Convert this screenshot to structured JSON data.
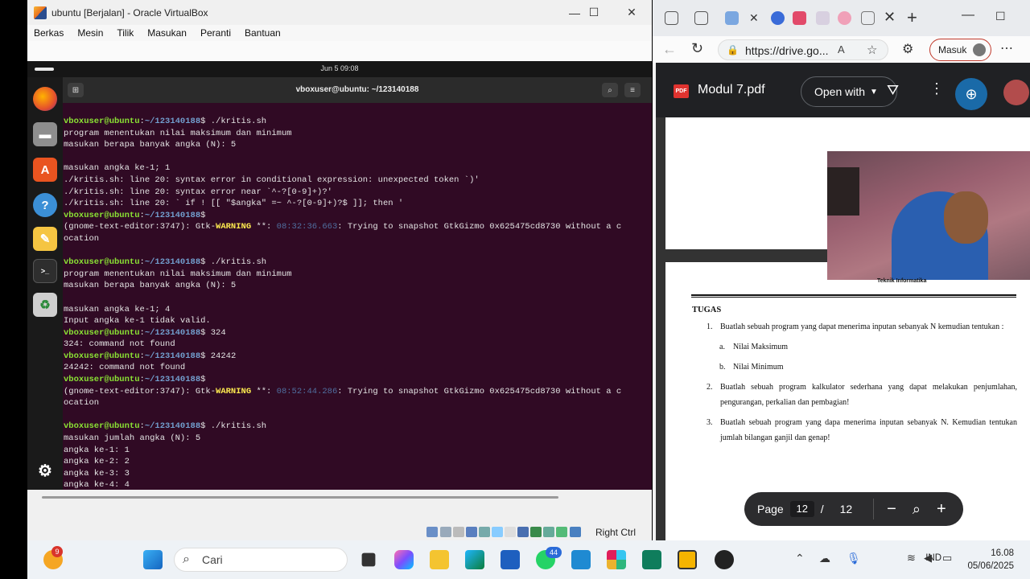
{
  "vbox": {
    "title": "ubuntu [Berjalan] - Oracle VirtualBox",
    "menu": [
      "Berkas",
      "Mesin",
      "Tilik",
      "Masukan",
      "Peranti",
      "Bantuan"
    ],
    "host_key": "Right Ctrl"
  },
  "guest": {
    "clock": "Jun 5  09:08",
    "terminal_title": "vboxuser@ubuntu: ~/123140188"
  },
  "terminal": {
    "user_host": "vboxuser@ubuntu",
    "path": "~/123140188",
    "lines": [
      {
        "type": "prompt",
        "cmd": " ./kritis.sh"
      },
      {
        "type": "text",
        "text": "program menentukan nilai maksimum dan minimum"
      },
      {
        "type": "text",
        "text": "masukan berapa banyak angka (N): 5"
      },
      {
        "type": "text",
        "text": ""
      },
      {
        "type": "text",
        "text": "masukan angka ke-1; 1"
      },
      {
        "type": "text",
        "text": "./kritis.sh: line 20: syntax error in conditional expression: unexpected token `)'"
      },
      {
        "type": "text",
        "text": "./kritis.sh: line 20: syntax error near `^-?[0-9]+)?'"
      },
      {
        "type": "text",
        "text": "./kritis.sh: line 20: ` if ! [[ \"$angka\" =~ ^-?[0-9]+)?$ ]]; then '"
      },
      {
        "type": "prompt",
        "cmd": ""
      },
      {
        "type": "warn",
        "pre": "(gnome-text-editor:3747): Gtk-",
        "warn": "WARNING",
        "mid": " **: ",
        "time": "08:32:36.663",
        "post": ": Trying to snapshot GtkGizmo 0x625475cd8730 without a c"
      },
      {
        "type": "text",
        "text": "ocation"
      },
      {
        "type": "text",
        "text": ""
      },
      {
        "type": "prompt",
        "cmd": " ./kritis.sh"
      },
      {
        "type": "text",
        "text": "program menentukan nilai maksimum dan minimum"
      },
      {
        "type": "text",
        "text": "masukan berapa banyak angka (N): 5"
      },
      {
        "type": "text",
        "text": ""
      },
      {
        "type": "text",
        "text": "masukan angka ke-1; 4"
      },
      {
        "type": "text",
        "text": "Input angka ke-1 tidak valid."
      },
      {
        "type": "prompt",
        "cmd": " 324"
      },
      {
        "type": "text",
        "text": "324: command not found"
      },
      {
        "type": "prompt",
        "cmd": " 24242"
      },
      {
        "type": "text",
        "text": "24242: command not found"
      },
      {
        "type": "prompt",
        "cmd": ""
      },
      {
        "type": "warn",
        "pre": "(gnome-text-editor:3747): Gtk-",
        "warn": "WARNING",
        "mid": " **: ",
        "time": "08:52:44.286",
        "post": ": Trying to snapshot GtkGizmo 0x625475cd8730 without a c"
      },
      {
        "type": "text",
        "text": "ocation"
      },
      {
        "type": "text",
        "text": ""
      },
      {
        "type": "prompt",
        "cmd": " ./kritis.sh"
      },
      {
        "type": "text",
        "text": "masukan jumlah angka (N): 5"
      },
      {
        "type": "text",
        "text": "angka ke-1: 1"
      },
      {
        "type": "text",
        "text": "angka ke-2: 2"
      },
      {
        "type": "text",
        "text": "angka ke-3: 3"
      },
      {
        "type": "text",
        "text": "angka ke-4: 4"
      }
    ]
  },
  "edge": {
    "url": "https://drive.go...",
    "signin_label": "Masuk"
  },
  "drive": {
    "pdf_badge": "PDF",
    "filename": "Modul 7.pdf",
    "open_with": "Open with",
    "page_label": "Page",
    "current_page": "12",
    "separator": "/",
    "total_pages": "12"
  },
  "document": {
    "header_label": "Teknik Informatika",
    "heading": "TUGAS",
    "items": [
      {
        "num": "1.",
        "text": "Buatlah sebuah program yang dapat menerima inputan sebanyak N kemudian tentukan :"
      },
      {
        "num": "a.",
        "text": "Nilai Maksimum",
        "sub": true
      },
      {
        "num": "b.",
        "text": "Nilai Minimum",
        "sub": true
      },
      {
        "num": "2.",
        "text": "Buatlah sebuah program kalkulator sederhana yang dapat melakukan penjumlahan, pengurangan, perkalian dan pembagian!"
      },
      {
        "num": "3.",
        "text": "Buatlah sebuah program yang dapa menerima inputan sebanyak N. Kemudian tentukan jumlah bilangan ganjil dan genap!"
      }
    ]
  },
  "taskbar": {
    "badge_left": "9",
    "search_placeholder": "Cari",
    "whatsapp_badge": "44",
    "language": "IND",
    "time": "16.08",
    "date": "05/06/2025"
  }
}
